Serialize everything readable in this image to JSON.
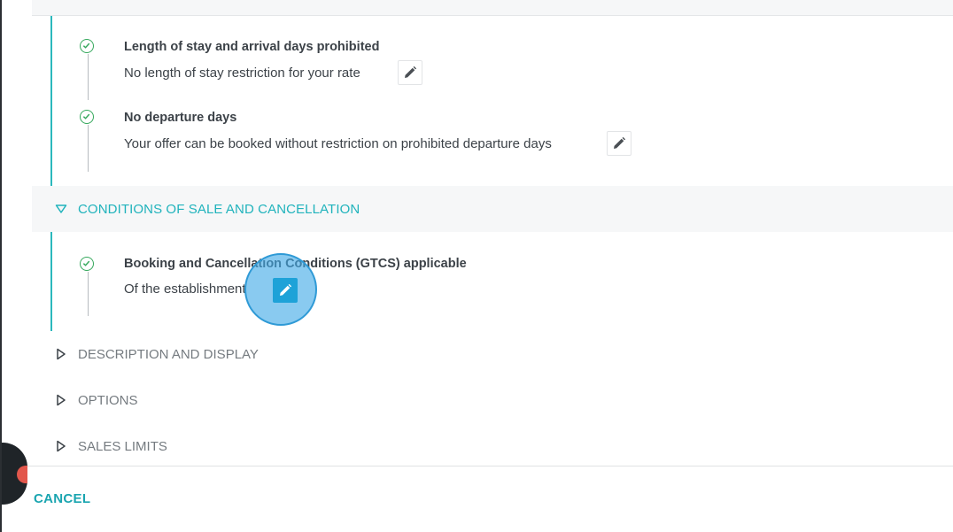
{
  "restrictions": {
    "items": [
      {
        "title": "Length of stay and arrival days prohibited",
        "subtitle": "No length of stay restriction for your rate"
      },
      {
        "title": "No departure days",
        "subtitle": "Your offer can be booked without restriction on prohibited departure days"
      }
    ]
  },
  "conditions": {
    "header": "CONDITIONS OF SALE AND CANCELLATION",
    "expanded": true,
    "items": [
      {
        "title": "Booking and Cancellation Conditions (GTCS) applicable",
        "subtitle": "Of the establishment"
      }
    ]
  },
  "sections": [
    {
      "label": "DESCRIPTION AND DISPLAY"
    },
    {
      "label": "OPTIONS"
    },
    {
      "label": "SALES LIMITS"
    }
  ],
  "footer": {
    "cancel_label": "CANCEL"
  },
  "colors": {
    "accent": "#20b3bc",
    "check": "#35a85c",
    "click_highlight": "#40aae6",
    "notification": "#e2574c"
  },
  "icons": {
    "step_status": "check-circle-icon",
    "edit": "pencil-icon",
    "expanded": "triangle-down-icon",
    "collapsed": "triangle-right-icon"
  }
}
